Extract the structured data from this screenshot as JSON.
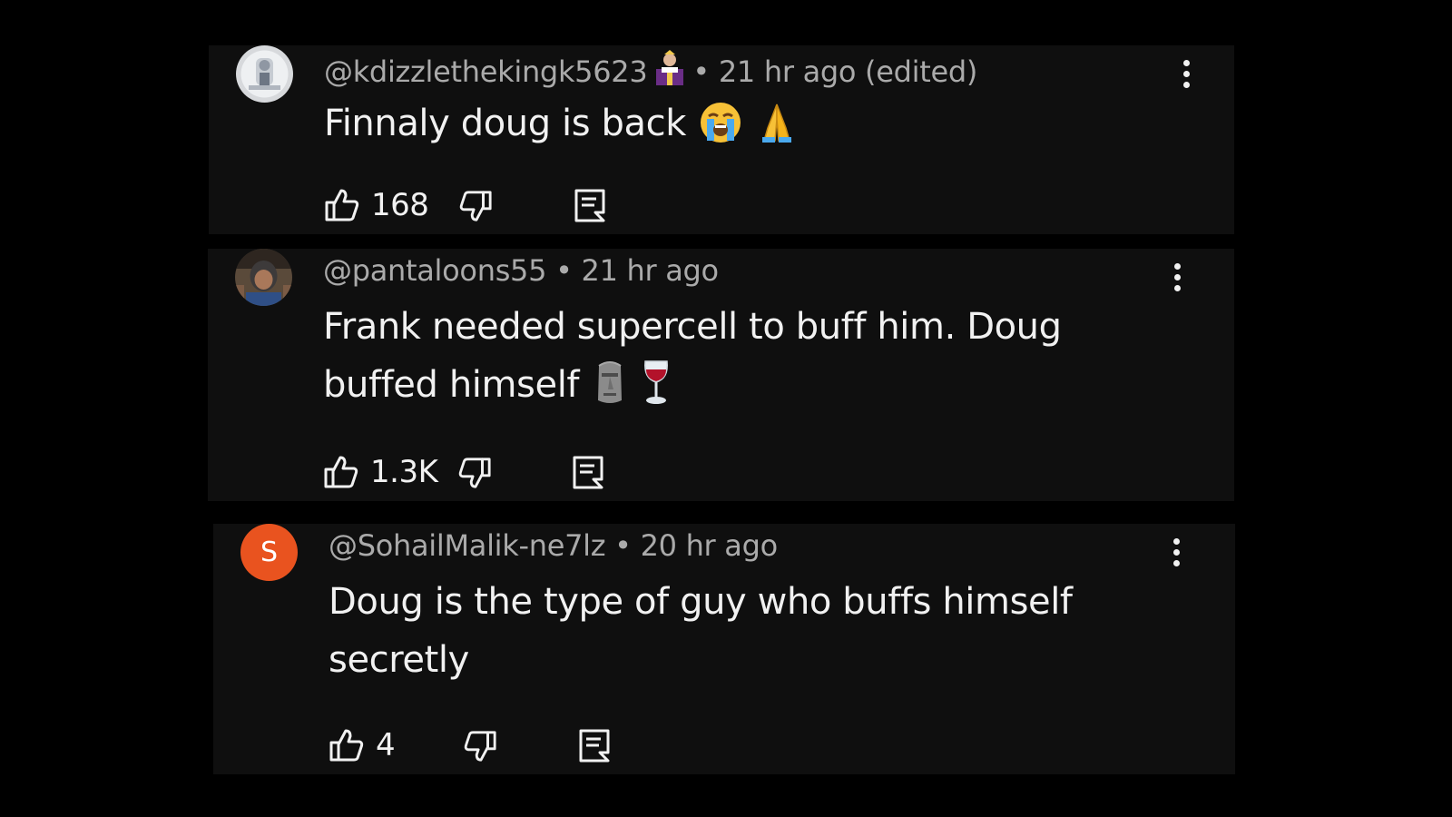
{
  "comments": [
    {
      "handle": "@kdizzlethekingk5623",
      "meta": "• 21 hr ago (edited)",
      "text": "Finnaly doug is back",
      "emojis": [
        "loudly-crying-face",
        "folded-hands"
      ],
      "likes": "168",
      "has_member_badge": true
    },
    {
      "handle": "@pantaloons55",
      "meta": "• 21 hr ago",
      "text": "Frank needed supercell to buff him. Doug buffed himself",
      "emojis": [
        "moai",
        "wine-glass"
      ],
      "likes": "1.3K"
    },
    {
      "handle": "@SohailMalik-ne7lz",
      "meta": "• 20 hr ago",
      "text": "Doug is the type of guy who buffs himself secretly",
      "emojis": [],
      "likes": "4",
      "avatar_letter": "S",
      "avatar_color": "#e9531f"
    }
  ],
  "icons": {
    "like": "thumbs-up-icon",
    "dislike": "thumbs-down-icon",
    "reply": "reply-icon",
    "more": "more-vertical-icon"
  },
  "colors": {
    "background": "#000000",
    "card": "#0f0f0f",
    "text": "#f1f1f1",
    "meta": "#aaaaaa"
  }
}
